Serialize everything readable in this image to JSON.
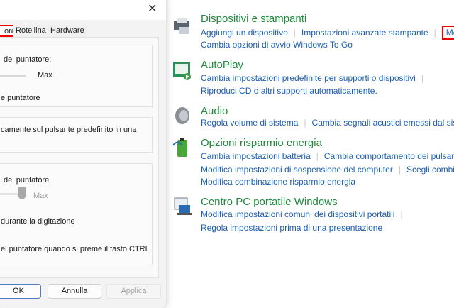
{
  "dialog": {
    "tabs": [
      "ore",
      "Rotellina",
      "Hardware"
    ],
    "speed_label": "del puntatore:",
    "max1": "Max",
    "precision": "e puntatore",
    "snap": "camente sul pulsante predefinito in una",
    "trail_label": "del puntatore",
    "max2": "Max",
    "hide": "durante la digitazione",
    "ctrl": "el puntatore quando si preme il tasto CTRL",
    "ok": "OK",
    "cancel": "Annulla",
    "apply": "Applica",
    "close": "✕"
  },
  "sections": [
    {
      "title": "Dispositivi e stampanti",
      "rows": [
        [
          "Aggiungi un dispositivo",
          "Impostazioni avanzate stampante",
          "Mouse"
        ],
        [
          "Cambia opzioni di avvio Windows To Go"
        ]
      ]
    },
    {
      "title": "AutoPlay",
      "rows": [
        [
          "Cambia impostazioni predefinite per supporti o dispositivi"
        ],
        [
          "Riproduci CD o altri supporti automaticamente."
        ]
      ]
    },
    {
      "title": "Audio",
      "rows": [
        [
          "Regola volume di sistema",
          "Cambia segnali acustici emessi dal sistema"
        ]
      ]
    },
    {
      "title": "Opzioni risparmio energia",
      "rows": [
        [
          "Cambia impostazioni batteria",
          "Cambia comportamento dei pulsanti"
        ],
        [
          "Modifica impostazioni di sospensione del computer",
          "Scegli combinazione"
        ],
        [
          "Modifica combinazione risparmio energia"
        ]
      ]
    },
    {
      "title": "Centro PC portatile Windows",
      "rows": [
        [
          "Modifica impostazioni comuni dei dispositivi portatili"
        ],
        [
          "Regola impostazioni prima di una presentazione"
        ]
      ]
    }
  ]
}
